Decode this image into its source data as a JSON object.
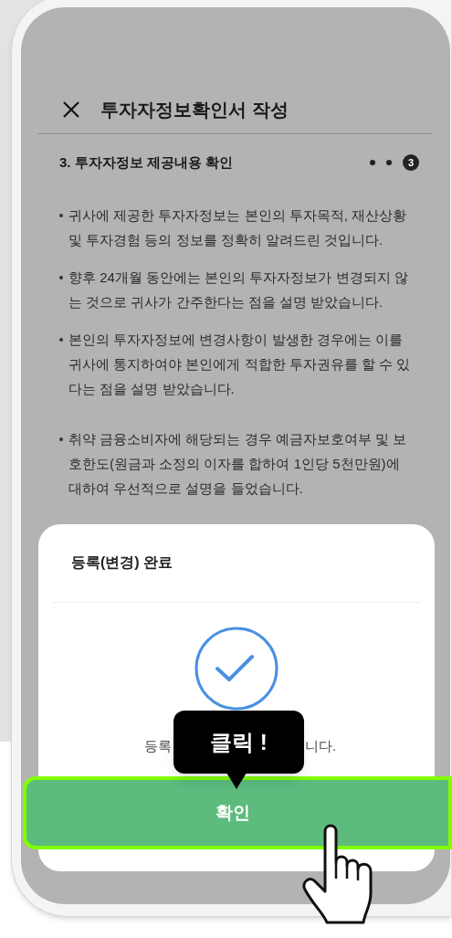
{
  "header": {
    "title": "투자자정보확인서 작성"
  },
  "section": {
    "title": "3. 투자자정보 제공내용 확인",
    "steps": [
      {
        "selected": false
      },
      {
        "selected": false
      },
      {
        "label": "3",
        "selected": true
      }
    ]
  },
  "bullets": [
    "귀사에 제공한 투자자정보는 본인의 투자목적, 재산상황 및 투자경험 등의 정보를 정확히 알려드린 것입니다.",
    "향후 24개월 동안에는 본인의 투자자정보가 변경되지 않는 것으로 귀사가 간주한다는 점을 설명 받았습니다.",
    "본인의 투자자정보에 변경사항이 발생한 경우에는 이를 귀사에 통지하여야 본인에게 적합한 투자권유를 할 수 있다는 점을 설명 받았습니다.",
    "취약 금융소비자에 해당되는 경우 예금자보호여부 및 보호한도(원금과 소정의 이자를 합하여 1인당 5천만원)에 대하여 우선적으로 설명을 들었습니다."
  ],
  "dialog": {
    "title": "등록(변경) 완료",
    "message_parts": [
      "등록",
      "니다."
    ],
    "button": "확인"
  },
  "tooltip": {
    "text": "클릭 !"
  }
}
